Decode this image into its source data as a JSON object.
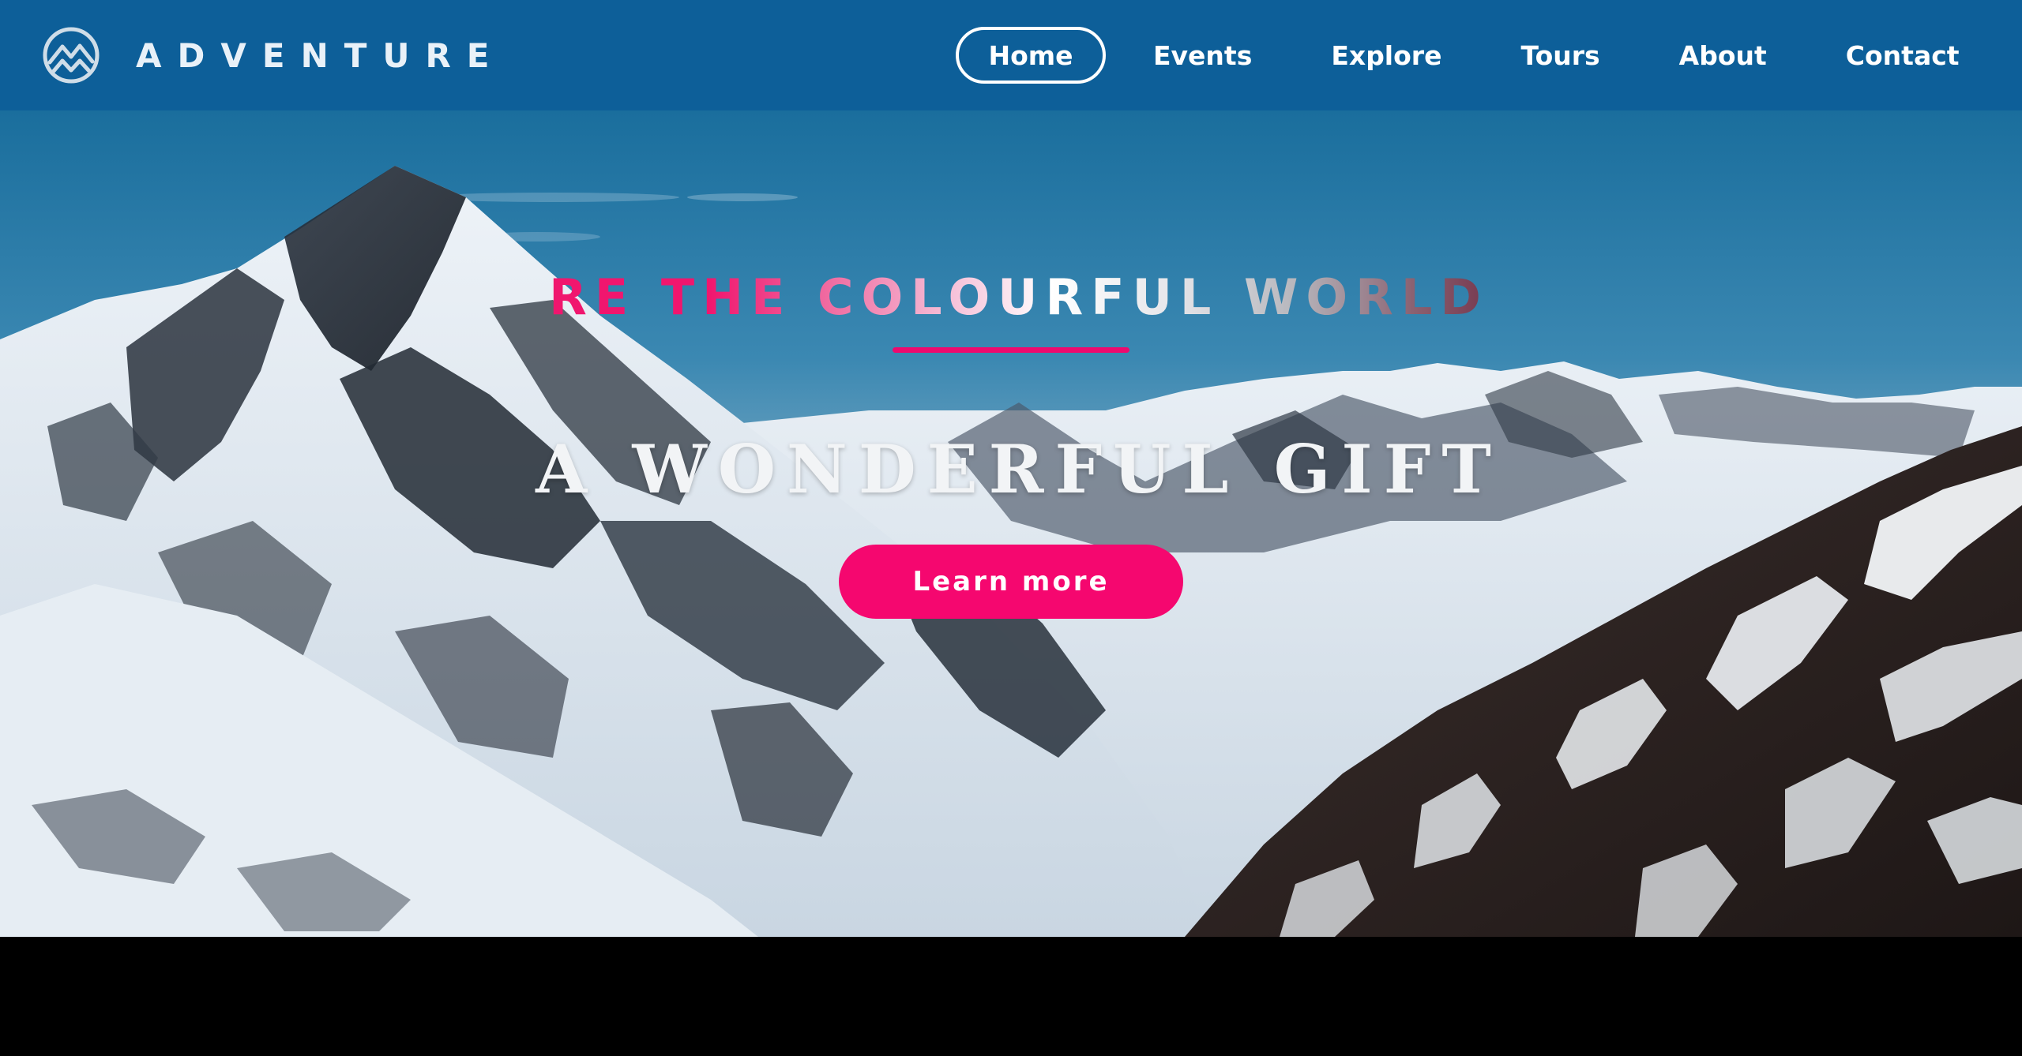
{
  "brand": {
    "name": "ADVENTURE",
    "logo_icon": "mountain-circle-icon"
  },
  "nav": {
    "items": [
      {
        "label": "Home",
        "active": true
      },
      {
        "label": "Events",
        "active": false
      },
      {
        "label": "Explore",
        "active": false
      },
      {
        "label": "Tours",
        "active": false
      },
      {
        "label": "About",
        "active": false
      },
      {
        "label": "Contact",
        "active": false
      }
    ]
  },
  "hero": {
    "tagline": "RE THE COLOURFUL WORLD",
    "title": "A WONDERFUL GIFT",
    "button_label": "Learn more",
    "background": "snowy-mountains-photo"
  },
  "colors": {
    "navbar_bg": "#0d5f99",
    "accent_pink": "#f5076f",
    "footer_bg": "#000000"
  }
}
